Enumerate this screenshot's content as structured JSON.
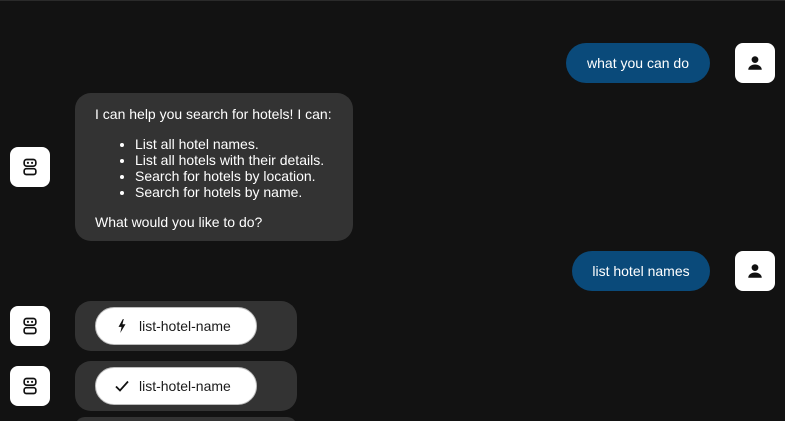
{
  "messages": {
    "user_1": {
      "text": "what you can do",
      "avatar_icon": "person-icon"
    },
    "bot_1": {
      "intro": "I can help you search for hotels! I can:",
      "items": [
        "List all hotel names.",
        "List all hotels with their details.",
        "Search for hotels by location.",
        "Search for hotels by name."
      ],
      "outro": "What would you like to do?",
      "avatar_icon": "robot-icon"
    },
    "user_2": {
      "text": "list hotel names",
      "avatar_icon": "person-icon"
    },
    "tool_call_1": {
      "label": "list-hotel-name",
      "status_icon": "lightning-icon",
      "avatar_icon": "robot-icon"
    },
    "tool_call_2": {
      "label": "list-hotel-name",
      "status_icon": "checkmark-icon",
      "avatar_icon": "robot-icon"
    }
  },
  "colors": {
    "background": "#121212",
    "user_bubble": "#0a4a7a",
    "bot_bubble": "#333333"
  }
}
